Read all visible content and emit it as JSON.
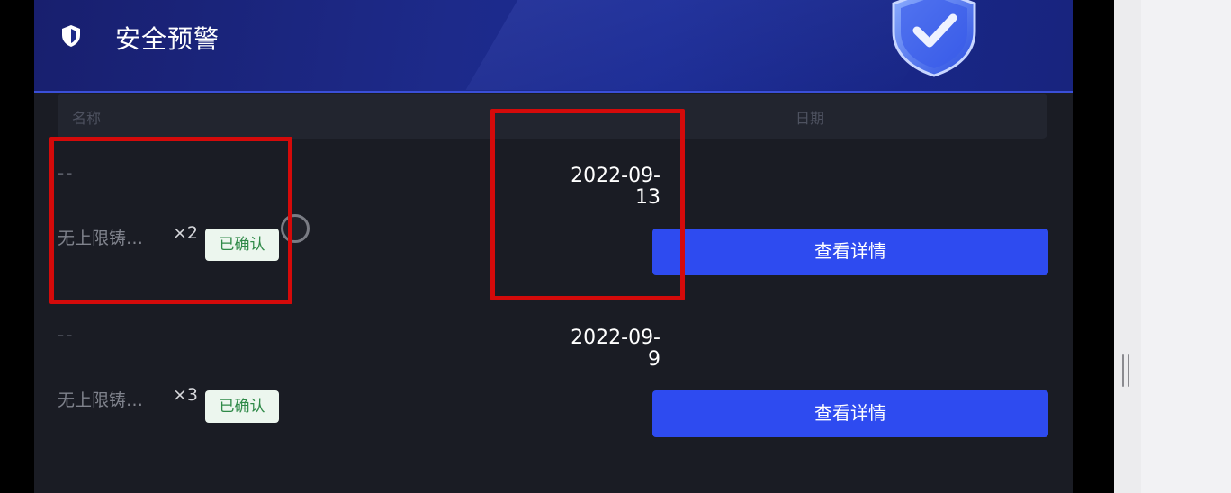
{
  "header": {
    "title": "安全预警",
    "icon": "shield-icon",
    "illustration": "shield-check-illustration"
  },
  "table": {
    "columns": {
      "name": "名称",
      "date": "日期"
    },
    "rows": [
      {
        "dash": "--",
        "name": "无上限铸…",
        "multiplier": "×2",
        "status": "已确认",
        "date_line1": "2022-09-",
        "date_line2": "13",
        "action": "查看详情"
      },
      {
        "dash": "--",
        "name": "无上限铸…",
        "multiplier": "×3",
        "status": "已确认",
        "date_line1": "2022-09-",
        "date_line2": "9",
        "action": "查看详情"
      }
    ]
  },
  "colors": {
    "accent": "#2e4bf0",
    "header": "#1d2a8a",
    "badge_text": "#2f8a48",
    "highlight": "#d40a0a"
  }
}
